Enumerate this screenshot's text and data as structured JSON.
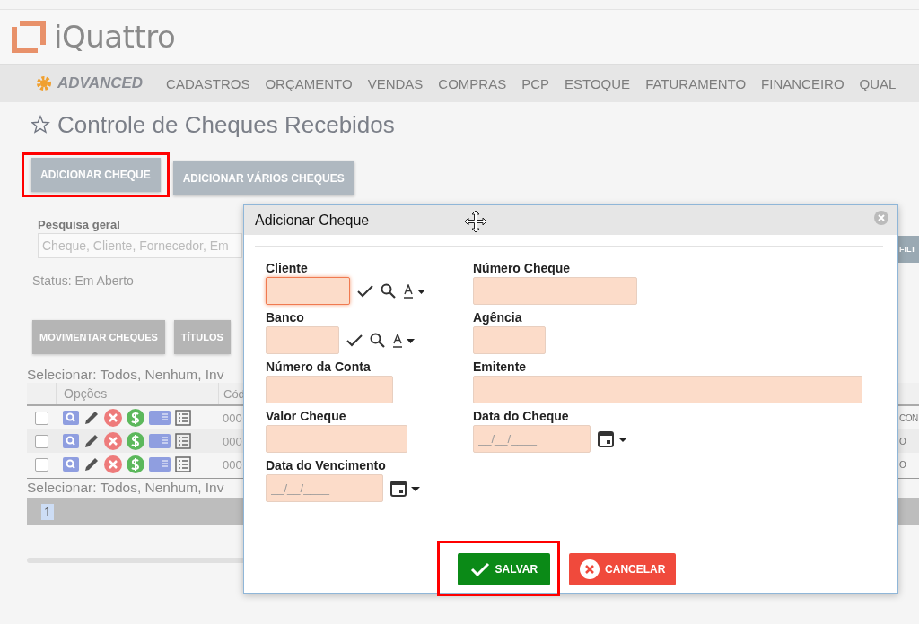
{
  "header": {
    "logo_text": "iQuattro"
  },
  "nav": {
    "brand": "ADVANCED",
    "items": [
      "CADASTROS",
      "ORÇAMENTO",
      "VENDAS",
      "COMPRAS",
      "PCP",
      "ESTOQUE",
      "FATURAMENTO",
      "FINANCEIRO",
      "QUAL"
    ]
  },
  "page": {
    "title": "Controle de Cheques Recebidos",
    "favorite": false
  },
  "top_buttons": [
    {
      "label": "ADICIONAR CHEQUE",
      "highlighted": true
    },
    {
      "label": "ADICIONAR VÁRIOS CHEQUES",
      "highlighted": false
    }
  ],
  "search": {
    "label": "Pesquisa geral",
    "placeholder": "Cheque, Cliente, Fornecedor, Em",
    "filter_button": "FILT"
  },
  "status": "Status: Em Aberto",
  "action_buttons": [
    "MOVIMENTAR CHEQUES",
    "TÍTULOS"
  ],
  "select_line_top": "Selecionar: Todos, Nenhum, Inv",
  "table": {
    "columns": [
      "Opções",
      "Cód"
    ],
    "rows": [
      {
        "checked": false,
        "code": "000",
        "last": "CON"
      },
      {
        "checked": false,
        "code": "000",
        "last": "O"
      },
      {
        "checked": false,
        "code": "000",
        "last": "O"
      }
    ]
  },
  "select_line_bottom": "Selecionar: Todos, Nenhum, Inv",
  "pagination": [
    {
      "label": "1",
      "selected": true
    }
  ],
  "dialog": {
    "title": "Adicionar Cheque",
    "fields": [
      {
        "label": "Cliente",
        "kind": "lookup",
        "focused": true
      },
      {
        "label": "Número Cheque",
        "kind": "text",
        "focused": false
      },
      {
        "label": "Banco",
        "kind": "lookup",
        "focused": false
      },
      {
        "label": "Agência",
        "kind": "text",
        "focused": false
      },
      {
        "label": "Número da Conta",
        "kind": "text",
        "focused": false
      },
      {
        "label": "Emitente",
        "kind": "text",
        "focused": false
      },
      {
        "label": "Valor Cheque",
        "kind": "text",
        "focused": false
      },
      {
        "label": "Data do Cheque",
        "kind": "date",
        "focused": false,
        "placeholder": "__/__/____"
      },
      {
        "label": "Data do Vencimento",
        "kind": "date",
        "focused": false,
        "placeholder": "__/__/____"
      }
    ],
    "buttons": [
      {
        "label": "SALVAR",
        "kind": "save",
        "highlighted": true
      },
      {
        "label": "CANCELAR",
        "kind": "cancel",
        "highlighted": false
      }
    ]
  }
}
